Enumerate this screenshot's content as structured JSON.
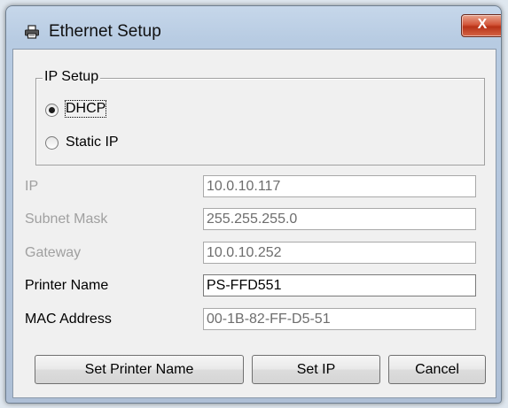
{
  "window": {
    "title": "Ethernet Setup",
    "close_label": "X",
    "title_icon": "printer-icon"
  },
  "ip_setup": {
    "group_title": "IP Setup",
    "options": [
      {
        "label": "DHCP",
        "selected": true
      },
      {
        "label": "Static IP",
        "selected": false
      }
    ]
  },
  "fields": {
    "ip": {
      "label": "IP",
      "value": "10.0.10.117",
      "enabled": false
    },
    "subnet_mask": {
      "label": "Subnet Mask",
      "value": "255.255.255.0",
      "enabled": false
    },
    "gateway": {
      "label": "Gateway",
      "value": "10.0.10.252",
      "enabled": false
    },
    "printer_name": {
      "label": "Printer Name",
      "value": "PS-FFD551",
      "enabled": true
    },
    "mac_address": {
      "label": "MAC Address",
      "value": "00-1B-82-FF-D5-51",
      "enabled": true
    }
  },
  "buttons": {
    "set_printer_name": "Set Printer Name",
    "set_ip": "Set IP",
    "cancel": "Cancel"
  }
}
